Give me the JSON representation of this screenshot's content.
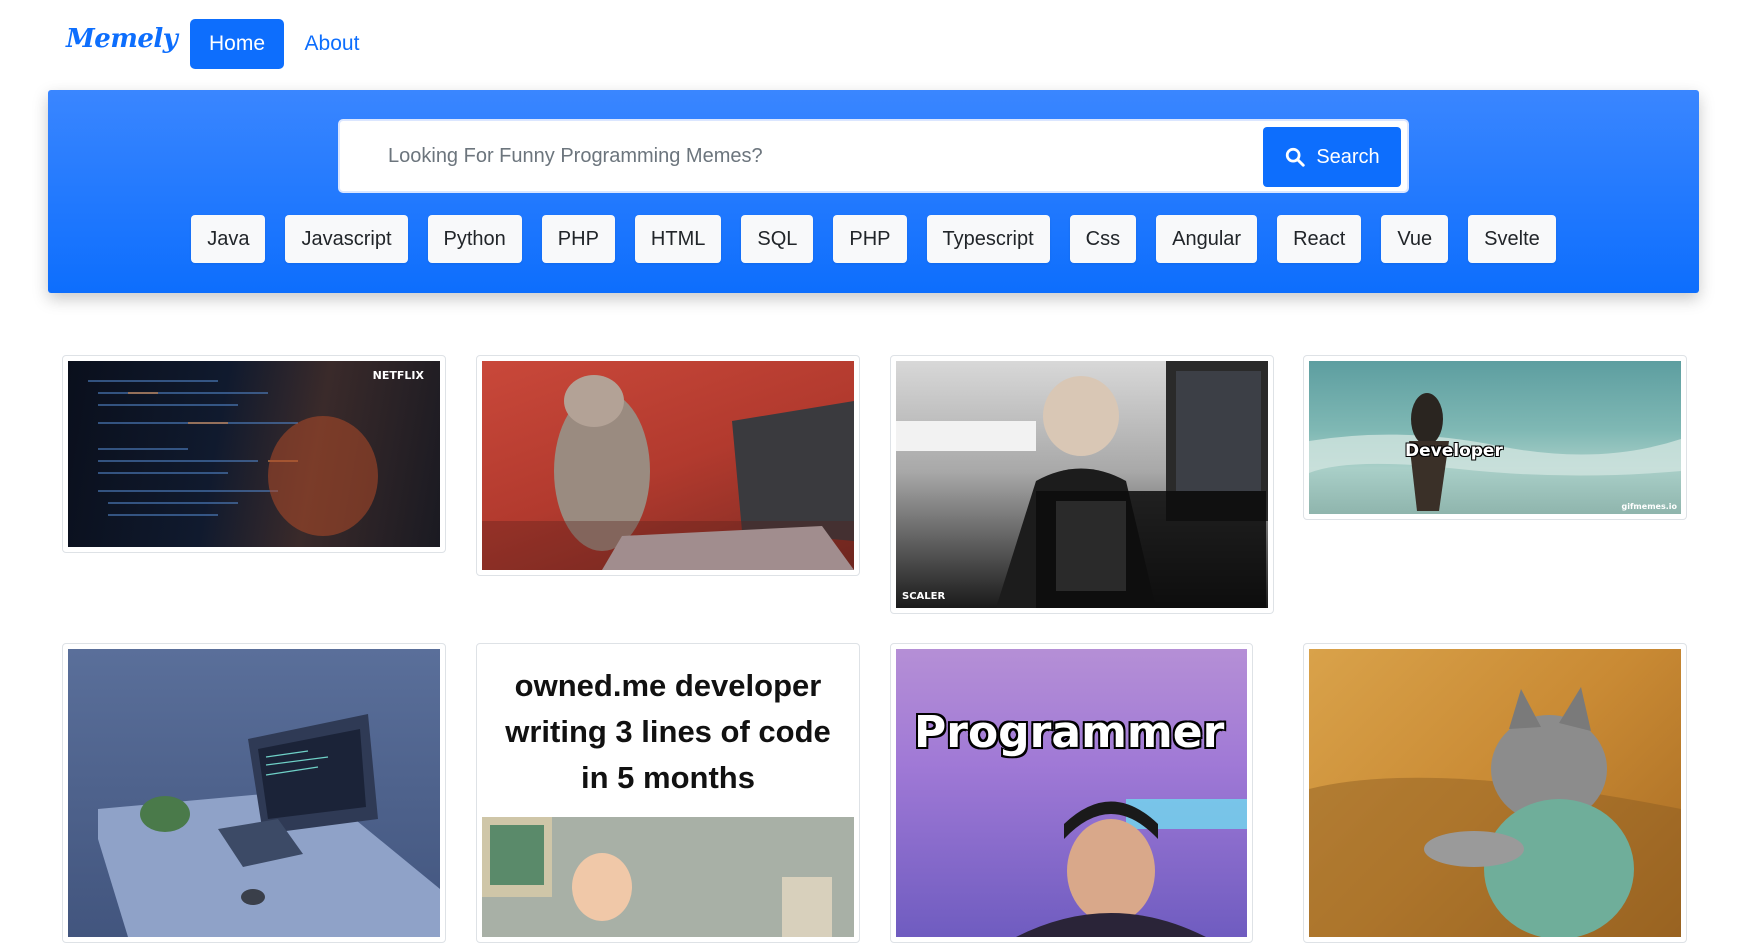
{
  "brand": "Memely",
  "nav": {
    "home": "Home",
    "about": "About"
  },
  "search": {
    "placeholder": "Looking For Funny Programming Memes?",
    "value": "",
    "button_label": "Search",
    "button_icon": "search-icon"
  },
  "tags": [
    "Java",
    "Javascript",
    "Python",
    "PHP",
    "HTML",
    "SQL",
    "PHP",
    "Typescript",
    "Css",
    "Angular",
    "React",
    "Vue",
    "Svelte"
  ],
  "gallery": {
    "memes": [
      {
        "caption": "NETFLIX"
      },
      {
        "caption": ""
      },
      {
        "caption": "SCALER"
      },
      {
        "caption": "Developer",
        "watermark": "gifmemes.io"
      },
      {
        "caption": ""
      },
      {
        "caption": "owned.me developer writing 3 lines of code in 5 months"
      },
      {
        "caption": "Programmer"
      },
      {
        "caption": ""
      }
    ]
  },
  "colors": {
    "primary": "#0d6efd",
    "hero_top": "#3a86ff",
    "tag_bg": "#f8f9fa"
  }
}
